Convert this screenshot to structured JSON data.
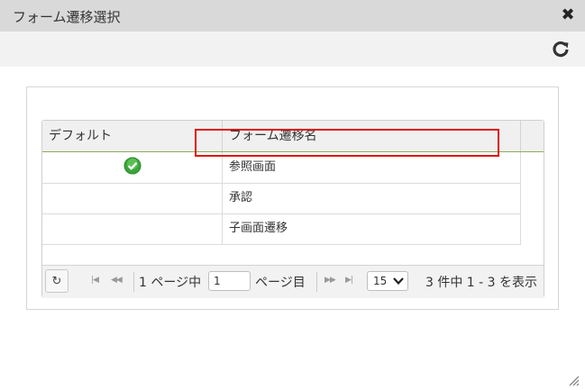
{
  "dialog": {
    "title": "フォーム遷移選択",
    "close_icon": "✖"
  },
  "toolbar": {
    "reload_icon": "reload-icon"
  },
  "grid": {
    "columns": [
      "デフォルト",
      "フォーム遷移名"
    ],
    "rows": [
      {
        "default": true,
        "name": "参照画面"
      },
      {
        "default": false,
        "name": "承認"
      },
      {
        "default": false,
        "name": "子画面遷移"
      }
    ]
  },
  "pager": {
    "refresh_icon": "↻",
    "first_icon": "|◀",
    "prev_icon": "◀◀",
    "next_icon": "▶▶",
    "last_icon": "▶|",
    "page_prefix": "1 ページ中",
    "page_value": "1",
    "page_suffix": "ページ目",
    "page_size": "15",
    "info": "3 件中 1 - 3 を表示"
  },
  "colors": {
    "highlight": "#e01010",
    "header_border": "#8dab5c",
    "check_green": "#3aa53a"
  }
}
